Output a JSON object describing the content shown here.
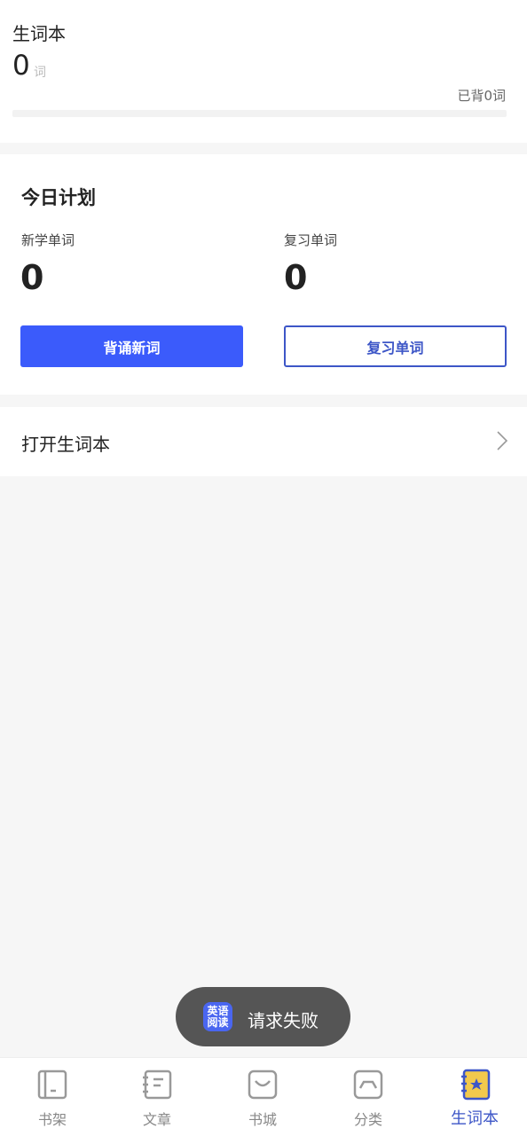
{
  "vocab_summary": {
    "title": "生词本",
    "count": "0",
    "unit": "词",
    "memorized": "已背0词",
    "progress": 0
  },
  "plan": {
    "title": "今日计划",
    "new_words": {
      "label": "新学单词",
      "value": "0"
    },
    "review_words": {
      "label": "复习单词",
      "value": "0"
    },
    "recite_button": "背诵新词",
    "review_button": "复习单词",
    "colors": {
      "accent": "#3b5bfb",
      "outline": "#3d56c7"
    }
  },
  "open_vocab": {
    "label": "打开生词本",
    "icon": "chevron-right-icon"
  },
  "toast": {
    "logo": [
      "英",
      "语",
      "阅",
      "读"
    ],
    "message": "请求失败"
  },
  "nav": {
    "items": [
      {
        "label": "书架",
        "icon": "bookshelf-icon",
        "active": false
      },
      {
        "label": "文章",
        "icon": "article-icon",
        "active": false
      },
      {
        "label": "书城",
        "icon": "bookstore-icon",
        "active": false
      },
      {
        "label": "分类",
        "icon": "category-icon",
        "active": false
      },
      {
        "label": "生词本",
        "icon": "vocab-book-icon",
        "active": true
      }
    ]
  }
}
